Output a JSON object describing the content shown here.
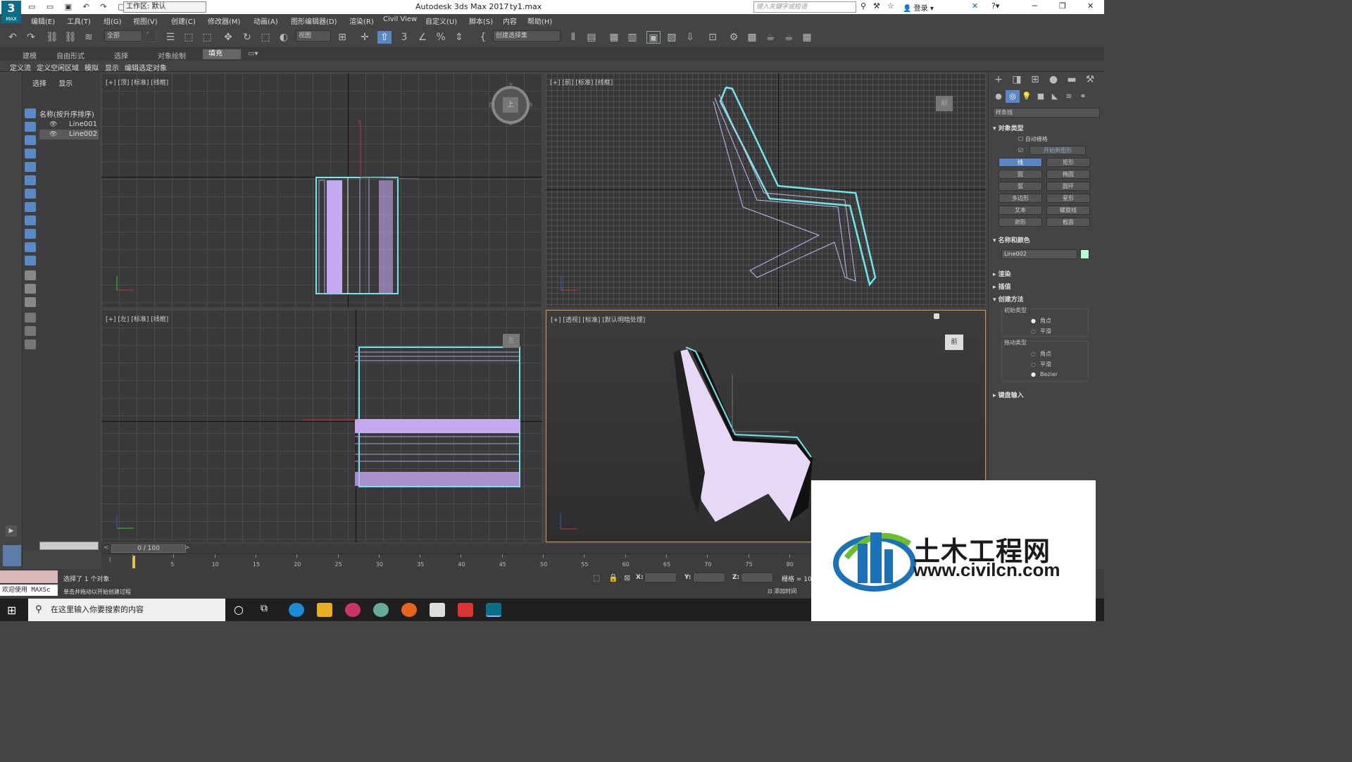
{
  "titlebar": {
    "logo_main": "3",
    "logo_sub": "MAX",
    "workspace": "工作区: 默认",
    "app_title": "Autodesk 3ds Max 2017",
    "file_name": "ty1.max",
    "search_placeholder": "键入关键字或短语",
    "login": "登录"
  },
  "menu": [
    "编辑(E)",
    "工具(T)",
    "组(G)",
    "视图(V)",
    "创建(C)",
    "修改器(M)",
    "动画(A)",
    "图形编辑器(D)",
    "渲染(R)",
    "Civil View",
    "自定义(U)",
    "脚本(S)",
    "内容",
    "帮助(H)"
  ],
  "toolbar": {
    "filter_dropdown": "全部",
    "refcoord_dropdown": "视图",
    "selection_set_dropdown": "创建选择集",
    "snap_label": "3"
  },
  "ribbon": {
    "tabs": [
      "建模",
      "自由形式",
      "选择",
      "对象绘制",
      "填充"
    ],
    "active_tab": "填充",
    "sub_items": [
      "定义流",
      "定义空闲区域",
      "模拟",
      "显示",
      "编辑选定对象"
    ]
  },
  "explorer": {
    "tabs": [
      "选择",
      "显示"
    ],
    "header": "名称(按升序排序)",
    "items": [
      {
        "name": "Line001",
        "selected": false
      },
      {
        "name": "Line002",
        "selected": true
      }
    ]
  },
  "viewports": {
    "top": {
      "label": "[+] [顶] [标准] [线框]",
      "axis_y": "y"
    },
    "front": {
      "label": "[+] [前] [标准] [线框]",
      "cube": "前"
    },
    "left": {
      "label": "[+] [左] [标准] [线框]",
      "cube": "左"
    },
    "persp": {
      "label": "[+] [透视] [标准] [默认明暗处理]",
      "cube": "前"
    }
  },
  "viewcube_top": {
    "center": "上",
    "n": "北",
    "s": "南",
    "w": "西",
    "e": "东"
  },
  "command_panel": {
    "category_dropdown": "样条线",
    "object_type": {
      "title": "对象类型",
      "autogrid": "自动栅格",
      "start_new_shape": "开始新图形",
      "buttons": [
        "线",
        "矩形",
        "圆",
        "椭圆",
        "弧",
        "圆环",
        "多边形",
        "星形",
        "文本",
        "螺旋线",
        "卵形",
        "截面"
      ],
      "active_button": "线"
    },
    "name_color": {
      "title": "名称和颜色",
      "name": "Line002",
      "color": "#b2ffd6"
    },
    "rollouts": [
      "渲染",
      "插值"
    ],
    "creation_method": {
      "title": "创建方法",
      "initial_type": {
        "label": "初始类型",
        "options": [
          "角点",
          "平滑"
        ],
        "selected": "角点"
      },
      "drag_type": {
        "label": "拖动类型",
        "options": [
          "角点",
          "平滑",
          "Bezier"
        ],
        "selected": "Bezier"
      }
    },
    "keyboard_entry": "键盘输入"
  },
  "timeslider": {
    "frame": "0 / 100"
  },
  "trackbar": {
    "ticks": [
      0,
      5,
      10,
      15,
      20,
      25,
      30,
      35,
      40,
      45,
      50,
      55,
      60,
      65,
      70,
      75,
      80
    ]
  },
  "status": {
    "line1": "选择了 1 个对象",
    "line2": "单击并拖动以开始创建过程",
    "welcome": "欢迎使用 MAXSc",
    "x_label": "X:",
    "y_label": "Y:",
    "z_label": "Z:",
    "grid_label": "栅格 = 10.",
    "add_time_tag": "添加时间"
  },
  "taskbar": {
    "search_placeholder": "在这里输入你要搜索的内容"
  },
  "watermark": {
    "title": "土木工程网",
    "url": "www.civilcn.com"
  }
}
